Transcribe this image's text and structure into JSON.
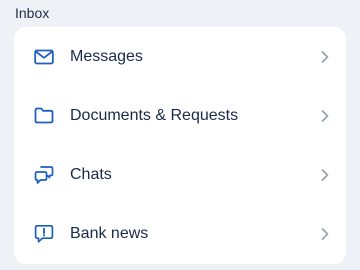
{
  "section": {
    "title": "Inbox"
  },
  "colors": {
    "accent": "#1f5fbf",
    "chevron": "#9aa3ae",
    "text": "#1a2a4a",
    "background": "#eef1f5",
    "card": "#ffffff"
  },
  "items": [
    {
      "label": "Messages",
      "icon": "envelope-icon"
    },
    {
      "label": "Documents & Requests",
      "icon": "folder-icon"
    },
    {
      "label": "Chats",
      "icon": "chat-bubbles-icon"
    },
    {
      "label": "Bank news",
      "icon": "alert-message-icon"
    }
  ]
}
